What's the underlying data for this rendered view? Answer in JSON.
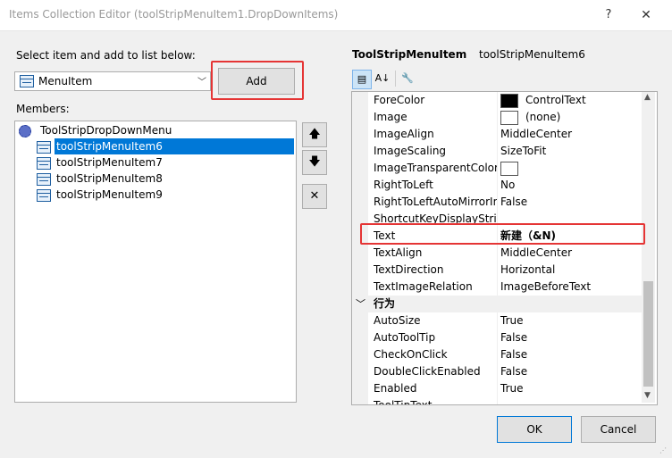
{
  "window": {
    "title": "Items Collection Editor (toolStripMenuItem1.DropDownItems)",
    "help_glyph": "?",
    "close_glyph": "✕"
  },
  "left": {
    "select_label": "Select item and add to list below:",
    "item_type_value": "MenuItem",
    "add_label": "Add",
    "members_label": "Members:",
    "tree_root": "ToolStripDropDownMenu",
    "tree_items": [
      "toolStripMenuItem6",
      "toolStripMenuItem7",
      "toolStripMenuItem8",
      "toolStripMenuItem9"
    ],
    "selected_index": 0,
    "move_up_glyph": "🡅",
    "move_down_glyph": "🡇",
    "delete_glyph": "✕"
  },
  "properties": {
    "type_label": "ToolStripMenuItem",
    "object_name": "toolStripMenuItem6",
    "rows": [
      {
        "name": "ForeColor",
        "value": "ControlText",
        "swatch": "#000000"
      },
      {
        "name": "Image",
        "value": "(none)",
        "swatch": "#ffffff"
      },
      {
        "name": "ImageAlign",
        "value": "MiddleCenter"
      },
      {
        "name": "ImageScaling",
        "value": "SizeToFit"
      },
      {
        "name": "ImageTransparentColor",
        "value": "",
        "swatch": "#ffffff"
      },
      {
        "name": "RightToLeft",
        "value": "No"
      },
      {
        "name": "RightToLeftAutoMirrorImage",
        "value": "False"
      },
      {
        "name": "ShortcutKeyDisplayString",
        "value": ""
      },
      {
        "name": "Text",
        "value": "新建（&N)"
      },
      {
        "name": "TextAlign",
        "value": "MiddleCenter"
      },
      {
        "name": "TextDirection",
        "value": "Horizontal"
      },
      {
        "name": "TextImageRelation",
        "value": "ImageBeforeText"
      }
    ],
    "category": "行为",
    "behavior_rows": [
      {
        "name": "AutoSize",
        "value": "True"
      },
      {
        "name": "AutoToolTip",
        "value": "False"
      },
      {
        "name": "CheckOnClick",
        "value": "False"
      },
      {
        "name": "DoubleClickEnabled",
        "value": "False"
      },
      {
        "name": "Enabled",
        "value": "True"
      },
      {
        "name": "ToolTipText",
        "value": ""
      }
    ]
  },
  "footer": {
    "ok_label": "OK",
    "cancel_label": "Cancel"
  },
  "colors": {
    "selection": "#0078d7",
    "highlight_box": "#e53535"
  }
}
